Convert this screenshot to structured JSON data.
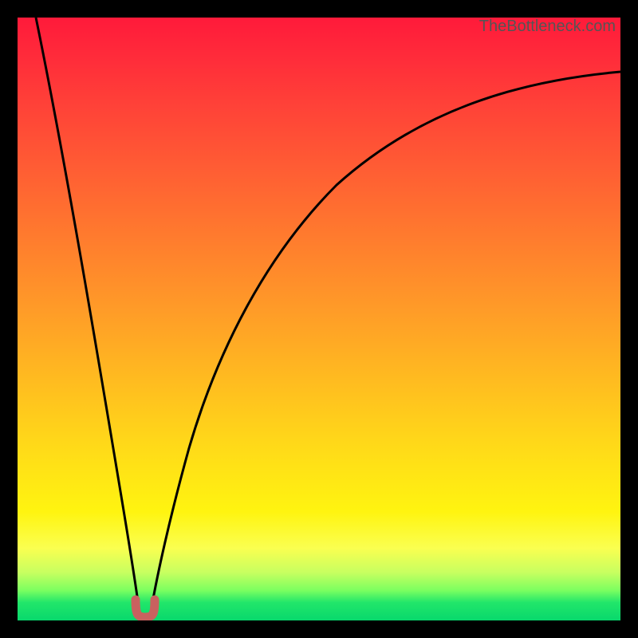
{
  "watermark": "TheBottleneck.com",
  "chart_data": {
    "type": "line",
    "title": "",
    "xlabel": "",
    "ylabel": "",
    "xlim": [
      0,
      100
    ],
    "ylim": [
      0,
      100
    ],
    "grid": false,
    "legend": false,
    "annotations": [
      {
        "text": "TheBottleneck.com",
        "position": "top-right",
        "color": "#555555"
      }
    ],
    "background_gradient": {
      "direction": "vertical",
      "stops": [
        {
          "pos": 0,
          "color": "#ff1a3a"
        },
        {
          "pos": 24,
          "color": "#ff5a34"
        },
        {
          "pos": 48,
          "color": "#ff9a28"
        },
        {
          "pos": 72,
          "color": "#ffdc18"
        },
        {
          "pos": 88,
          "color": "#faff50"
        },
        {
          "pos": 97,
          "color": "#22e66a"
        },
        {
          "pos": 100,
          "color": "#08d86c"
        }
      ]
    },
    "series": [
      {
        "name": "curve-left",
        "color": "#000000",
        "stroke_width": 3,
        "x": [
          3,
          5,
          7,
          9,
          11,
          13,
          15,
          17,
          18,
          19,
          19.5,
          20
        ],
        "y": [
          100,
          88,
          76,
          64,
          52,
          40,
          28,
          16,
          10,
          5,
          2.5,
          1
        ]
      },
      {
        "name": "curve-right",
        "color": "#000000",
        "stroke_width": 3,
        "x": [
          22,
          23,
          25,
          28,
          32,
          38,
          45,
          53,
          62,
          72,
          83,
          95,
          100
        ],
        "y": [
          1,
          3,
          9,
          18,
          30,
          44,
          56,
          66,
          74,
          80,
          84,
          87,
          88
        ]
      },
      {
        "name": "valley-marker",
        "type": "marker",
        "shape": "u",
        "color": "#c9615f",
        "stroke_width": 10,
        "x": [
          20,
          22
        ],
        "y": [
          2,
          2
        ]
      }
    ],
    "notes": "x and y are percentages of the plot-area width/height measured from bottom-left; values are visually estimated from the raster — no axis ticks or numeric labels are present in the source image."
  },
  "colors": {
    "frame": "#000000",
    "curve": "#000000",
    "marker": "#c9615f",
    "watermark": "#555555"
  }
}
